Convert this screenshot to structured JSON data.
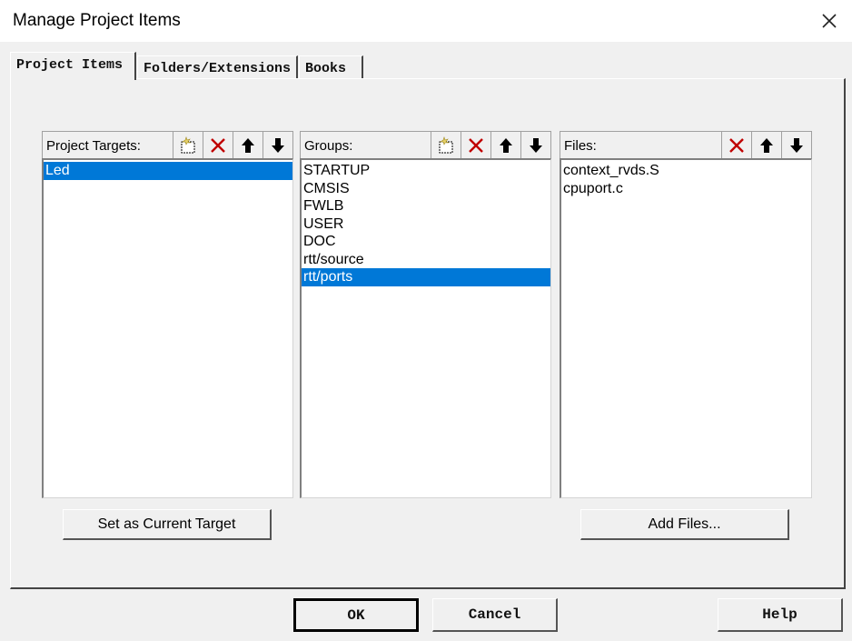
{
  "window": {
    "title": "Manage Project Items"
  },
  "tabs": [
    {
      "label": "Project Items",
      "active": true
    },
    {
      "label": "Folders/Extensions",
      "active": false
    },
    {
      "label": "Books",
      "active": false
    }
  ],
  "targets": {
    "label": "Project Targets:",
    "items": [
      "Led"
    ],
    "selected": "Led",
    "action_label": "Set as Current Target"
  },
  "groups": {
    "label": "Groups:",
    "items": [
      "STARTUP",
      "CMSIS",
      "FWLB",
      "USER",
      "DOC",
      "rtt/source",
      "rtt/ports"
    ],
    "selected": "rtt/ports"
  },
  "files": {
    "label": "Files:",
    "items": [
      "context_rvds.S",
      "cpuport.c"
    ],
    "action_label": "Add Files..."
  },
  "buttons": {
    "ok": "OK",
    "cancel": "Cancel",
    "help": "Help"
  },
  "colors": {
    "selection": "#0078d7",
    "delete_icon": "#c00000",
    "new_icon": "#e8d36a"
  }
}
